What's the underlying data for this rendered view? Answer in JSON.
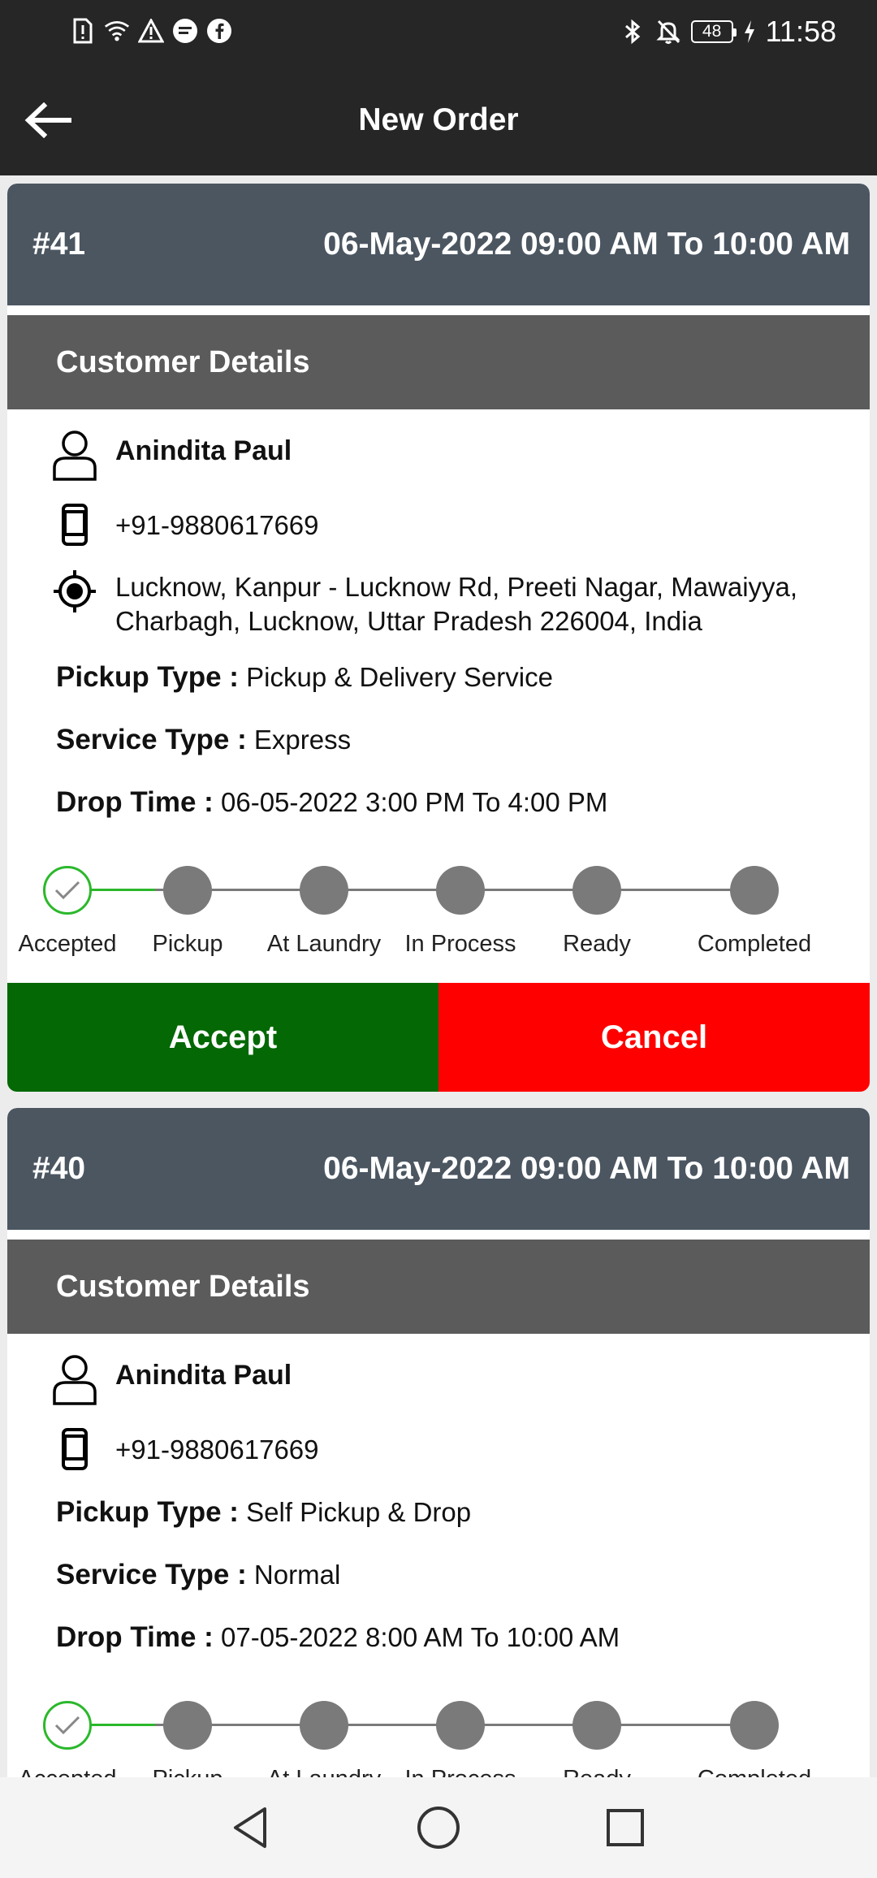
{
  "status_bar": {
    "time": "11:58",
    "battery": "48",
    "left_icons": [
      "sim-alert-icon",
      "wifi-icon",
      "warning-icon",
      "message-icon",
      "facebook-icon"
    ],
    "right_icons": [
      "bluetooth-icon",
      "bell-off-icon",
      "battery-icon",
      "charging-icon"
    ]
  },
  "app_bar": {
    "title": "New Order",
    "back_icon": "arrow-left-icon"
  },
  "orders": [
    {
      "id": "#41",
      "slot": "06-May-2022 09:00 AM To 10:00 AM",
      "section_title": "Customer Details",
      "customer_name": "Anindita Paul",
      "phone": "+91-9880617669",
      "address": "Lucknow, Kanpur - Lucknow Rd, Preeti Nagar, Mawaiyya, Charbagh, Lucknow, Uttar Pradesh 226004, India",
      "pickup_type_label": "Pickup Type :",
      "pickup_type": "Pickup & Delivery Service",
      "service_type_label": "Service Type :",
      "service_type": "Express",
      "drop_time_label": "Drop Time :",
      "drop_time": "06-05-2022 3:00 PM To 4:00 PM",
      "steps": [
        "Accepted",
        "Pickup",
        "At Laundry",
        "In Process",
        "Ready",
        "Completed"
      ],
      "completed_steps": 1,
      "accept_label": "Accept",
      "cancel_label": "Cancel"
    },
    {
      "id": "#40",
      "slot": "06-May-2022 09:00 AM To 10:00 AM",
      "section_title": "Customer Details",
      "customer_name": "Anindita Paul",
      "phone": "+91-9880617669",
      "pickup_type_label": "Pickup Type :",
      "pickup_type": "Self Pickup & Drop",
      "service_type_label": "Service Type :",
      "service_type": "Normal",
      "drop_time_label": "Drop Time :",
      "drop_time": "07-05-2022 8:00 AM To 10:00 AM",
      "steps": [
        "Accepted",
        "Pickup",
        "At Laundry",
        "In Process",
        "Ready",
        "Completed"
      ],
      "completed_steps": 1
    }
  ],
  "colors": {
    "header_bg": "#262626",
    "card_head": "#4b5661",
    "section_head": "#5b5b5b",
    "accept": "#046804",
    "cancel": "#ff0000",
    "step_done": "#2bb82b",
    "step_pending": "#7a7a7a"
  },
  "nav_bar": {
    "icons": [
      "back-triangle-icon",
      "home-circle-icon",
      "recents-square-icon"
    ]
  }
}
